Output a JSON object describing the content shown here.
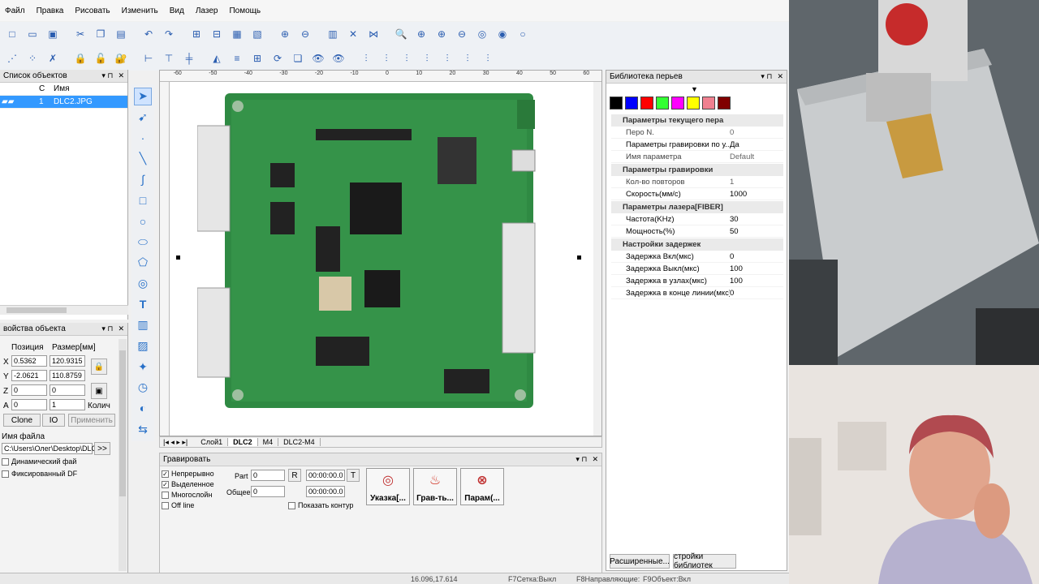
{
  "menu": [
    "Файл",
    "Правка",
    "Рисовать",
    "Изменить",
    "Вид",
    "Лазер",
    "Помощь"
  ],
  "object_list": {
    "title": "Список объектов",
    "col_c": "С",
    "col_name": "Имя",
    "rows": [
      {
        "index": "1",
        "name": "DLC2.JPG"
      }
    ]
  },
  "props": {
    "title": "войства объекта",
    "position_label": "Позиция",
    "size_label": "Размер[мм]",
    "axes": [
      "X",
      "Y",
      "Z",
      "A"
    ],
    "pos_values": [
      "0.5362",
      "-2.0621",
      "0",
      "0"
    ],
    "size_values": [
      "120.9315",
      "110.8759",
      "0",
      "1"
    ],
    "count_label": "Колич",
    "clone_btn": "Clone",
    "io_btn": "IO",
    "apply_btn": "Применить",
    "filename_label": "Имя файла",
    "filepath": "C:\\Users\\Олег\\Desktop\\DLC",
    "browse_btn": ">>",
    "dynamic_file": "Динамический фай",
    "fixed_df": "Фиксированный DF"
  },
  "ruler_marks": [
    "-60",
    "-50",
    "-40",
    "-30",
    "-20",
    "-10",
    "0",
    "10",
    "20",
    "30",
    "40",
    "50",
    "60"
  ],
  "tabs": [
    "Слой1",
    "DLC2",
    "M4",
    "DLC2-M4"
  ],
  "engrave": {
    "title": "Гравировать",
    "continuous": "Непрерывно",
    "selected": "Выделенное",
    "multilayer": "Многослойн",
    "offline": "Off line",
    "part_label": "Part",
    "part_value": "0",
    "total_label": "Общее",
    "total_value": "0",
    "r_btn": "R",
    "t_btn": "T",
    "time1": "00:00:00.0",
    "time2": "00:00:00.0",
    "show_contour": "Показать контур",
    "btn_pointer": "Указка[...",
    "btn_engrave": "Грав-ть...",
    "btn_params": "Парам(..."
  },
  "penlib": {
    "title": "Библиотека перьев",
    "colors": [
      "#000000",
      "#0000ff",
      "#ff0000",
      "#33ff33",
      "#ff00ff",
      "#ffff00",
      "#f08090",
      "#800000"
    ],
    "group1": "Параметры текущего пера",
    "pen_n_k": "Перо N.",
    "pen_n_v": "0",
    "eng_params_k": "Параметры гравировки по у...",
    "eng_params_v": "Да",
    "param_name_k": "Имя параметра",
    "param_name_v": "Default",
    "group2": "Параметры гравировки",
    "repeat_k": "Кол-во повторов",
    "repeat_v": "1",
    "speed_k": "Скорость(мм/с)",
    "speed_v": "1000",
    "group3": "Параметры лазера[FIBER]",
    "freq_k": "Частота(KHz)",
    "freq_v": "30",
    "power_k": "Мощность(%)",
    "power_v": "50",
    "group4": "Настройки задержек",
    "d_on_k": "Задержка Вкл(мкс)",
    "d_on_v": "0",
    "d_off_k": "Задержка Выкл(мкс)",
    "d_off_v": "100",
    "d_node_k": "Задержка в узлах(мкс)",
    "d_node_v": "100",
    "d_end_k": "Задержка в конце линии(мкс)",
    "d_end_v": "0",
    "btn_ext": "Расширенные...",
    "btn_lib": "стройки библиотек"
  },
  "status": {
    "coords": "16.096,17.614",
    "grid": "F7Сетка:Выкл",
    "dir": "F8Направляющие:",
    "obj": "F9Объект:Вкл"
  }
}
